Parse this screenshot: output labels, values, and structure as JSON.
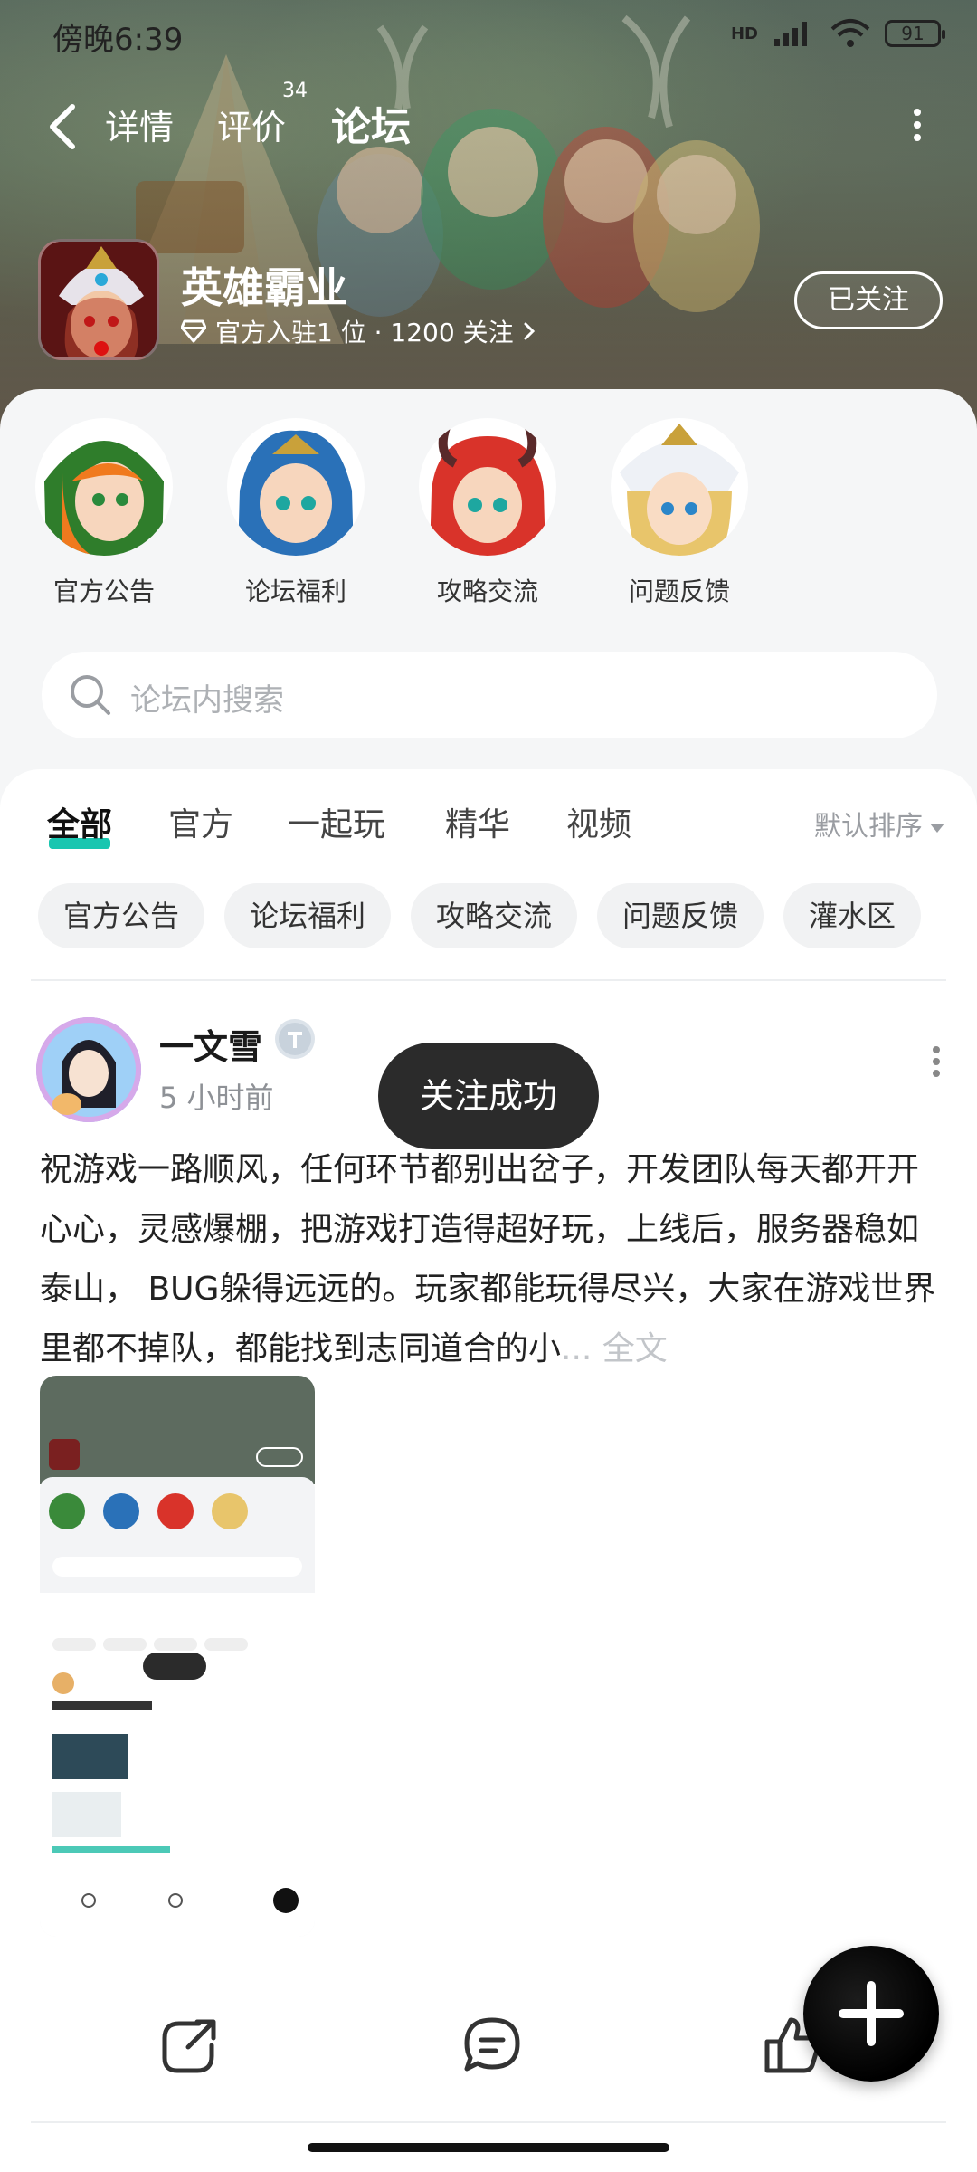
{
  "status": {
    "time": "傍晚6:39",
    "battery": "91",
    "network": "HD"
  },
  "nav": {
    "tabs": [
      {
        "label": "详情"
      },
      {
        "label": "评价",
        "badge": "34"
      },
      {
        "label": "论坛"
      }
    ],
    "active_tab": "论坛"
  },
  "app": {
    "name": "英雄霸业",
    "meta": "官方入驻1 位 · 1200 关注",
    "follow_label": "已关注"
  },
  "categories": [
    {
      "label": "官方公告"
    },
    {
      "label": "论坛福利"
    },
    {
      "label": "攻略交流"
    },
    {
      "label": "问题反馈"
    }
  ],
  "search": {
    "placeholder": "论坛内搜索"
  },
  "feed_tabs": [
    "全部",
    "官方",
    "一起玩",
    "精华",
    "视频"
  ],
  "sort_label": "默认排序",
  "chips": [
    "官方公告",
    "论坛福利",
    "攻略交流",
    "问题反馈",
    "灌水区"
  ],
  "post": {
    "author": "一文雪",
    "time": "5 小时前",
    "content": "祝游戏一路顺风，任何环节都别出岔子，开发团队每天都开开心心，灵感爆棚，把游戏打造得超好玩，上线后，服务器稳如泰山， BUG躲得远远的。玩家都能玩得尽兴，大家在游戏世界里都不掉队，都能找到志同道合的小",
    "ellipsis": "... ",
    "more_label": "全文"
  },
  "toast": "关注成功",
  "colors": {
    "accent": "#19c6b0",
    "background": "#f5f6f7"
  },
  "icons": {
    "back": "chevron-left-icon",
    "more": "more-vertical-icon",
    "verified": "diamond-icon",
    "search": "search-icon",
    "share": "share-icon",
    "comment": "comment-icon",
    "like": "thumbs-up-icon",
    "create": "plus-icon"
  }
}
